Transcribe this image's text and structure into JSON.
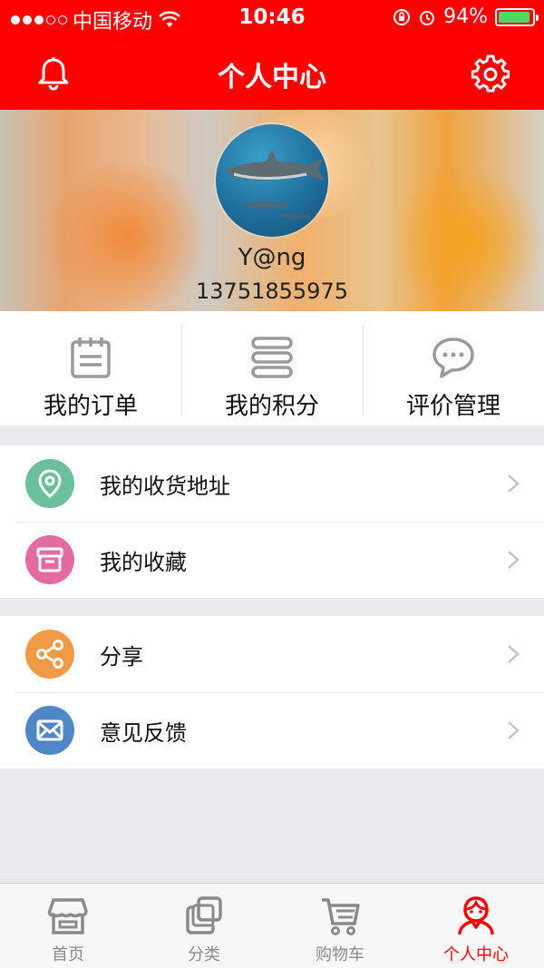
{
  "status_bar": {
    "carrier": "中国移动",
    "time": "10:46",
    "battery": "94%",
    "battery_level": 0.94
  },
  "header": {
    "title": "个人中心",
    "left_icon": "bell-icon",
    "right_icon": "gear-icon"
  },
  "profile": {
    "username": "Y@ng",
    "phone": "13751855975"
  },
  "quick_actions": [
    {
      "label": "我的订单",
      "icon": "calendar-icon"
    },
    {
      "label": "我的积分",
      "icon": "stack-icon"
    },
    {
      "label": "评价管理",
      "icon": "chat-bubble-icon"
    }
  ],
  "menu_group_1": [
    {
      "label": "我的收货地址",
      "icon": "location-pin-icon",
      "color": "#6bbf9a"
    },
    {
      "label": "我的收藏",
      "icon": "archive-box-icon",
      "color": "#e26ba1"
    }
  ],
  "menu_group_2": [
    {
      "label": "分享",
      "icon": "share-icon",
      "color": "#f09a48"
    },
    {
      "label": "意见反馈",
      "icon": "mail-icon",
      "color": "#4f86c6"
    }
  ],
  "tabbar": [
    {
      "label": "首页",
      "icon": "storefront-icon",
      "active": false
    },
    {
      "label": "分类",
      "icon": "copy-icon",
      "active": false
    },
    {
      "label": "购物车",
      "icon": "cart-icon",
      "active": false
    },
    {
      "label": "个人中心",
      "icon": "person-icon",
      "active": true
    }
  ],
  "colors": {
    "brand": "#ff0000",
    "background": "#e8eaee",
    "icon_gray": "#9a9a9a"
  }
}
